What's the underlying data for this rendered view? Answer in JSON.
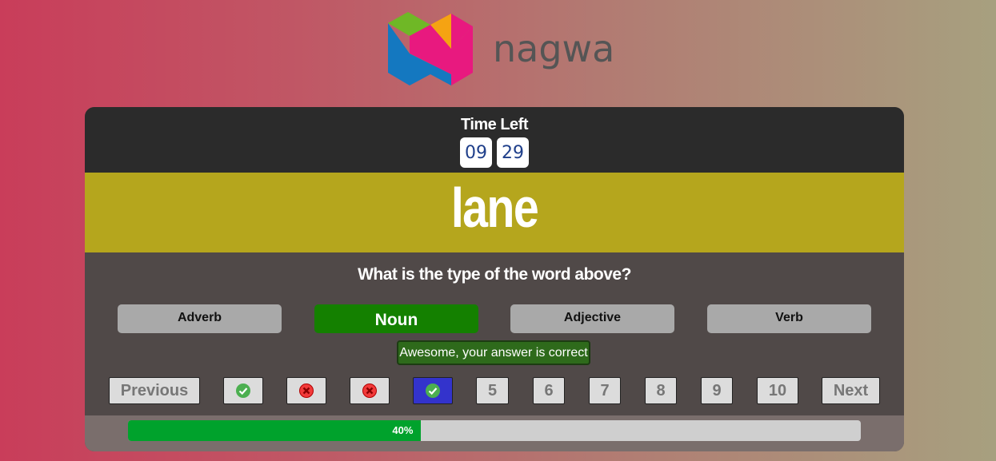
{
  "brand": {
    "name": "nagwa"
  },
  "timer": {
    "label": "Time Left",
    "minutes": "09",
    "seconds": "29"
  },
  "question": {
    "word": "lane",
    "prompt": "What is the type of the word above?",
    "options": [
      {
        "label": "Adverb",
        "state": "default"
      },
      {
        "label": "Noun",
        "state": "correct"
      },
      {
        "label": "Adjective",
        "state": "default"
      },
      {
        "label": "Verb",
        "state": "default"
      }
    ],
    "feedback": "Awesome, your answer is correct"
  },
  "navigation": {
    "previous_label": "Previous",
    "next_label": "Next",
    "items": [
      {
        "result": "correct",
        "icon": "check-circle-icon"
      },
      {
        "result": "incorrect",
        "icon": "x-circle-icon"
      },
      {
        "result": "incorrect",
        "icon": "x-circle-icon"
      },
      {
        "result": "correct",
        "icon": "check-circle-icon",
        "current": true
      },
      {
        "label": "5"
      },
      {
        "label": "6"
      },
      {
        "label": "7"
      },
      {
        "label": "8"
      },
      {
        "label": "9"
      },
      {
        "label": "10"
      }
    ]
  },
  "progress": {
    "value": 0.4,
    "label": "40%"
  },
  "colors": {
    "correct": "#148000",
    "word_bar": "#b5a61d",
    "timer_bar": "#2b2b2b",
    "progress_fill": "#00a22c",
    "current_question": "#3333cc"
  }
}
